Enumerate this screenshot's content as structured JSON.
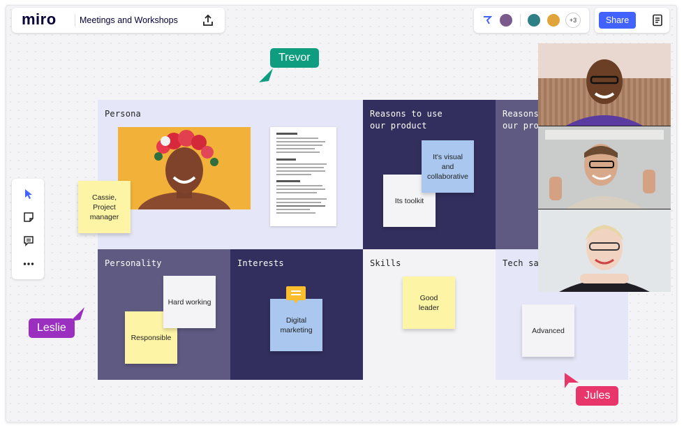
{
  "header": {
    "logo": "miro",
    "board_title": "Meetings and Workshops",
    "collaborator_overflow": "+3",
    "share_label": "Share"
  },
  "board": {
    "cells": [
      {
        "title": "Persona"
      },
      {
        "title": "Reasons to use\nour product"
      },
      {
        "title": "Reasons to use\nour product"
      },
      {
        "title": "Personality"
      },
      {
        "title": "Interests"
      },
      {
        "title": "Skills"
      },
      {
        "title": "Tech savvy"
      }
    ],
    "stickies": {
      "persona_name": "Cassie,\nProject\nmanager",
      "visual": "It's visual and\ncollaborative",
      "toolkit": "Its toolkit",
      "hard_working": "Hard working",
      "responsible": "Responsible",
      "digital_marketing": "Digital\nmarketing",
      "good_leader": "Good\nleader",
      "advanced": "Advanced"
    }
  },
  "cursors": [
    {
      "name": "Trevor",
      "color": "#0f9d7f"
    },
    {
      "name": "Leslie",
      "color": "#9b30c0"
    },
    {
      "name": "Jules",
      "color": "#e8356a"
    }
  ],
  "colors": {
    "share": "#4262ff",
    "persona_bg": "#e5e7f8",
    "dark_navy": "#322f5e",
    "slate": "#5f5a82",
    "sticky_yellow": "#fdf4a6",
    "sticky_blue": "#a9c7ef",
    "sticky_white": "#f4f4f6"
  }
}
